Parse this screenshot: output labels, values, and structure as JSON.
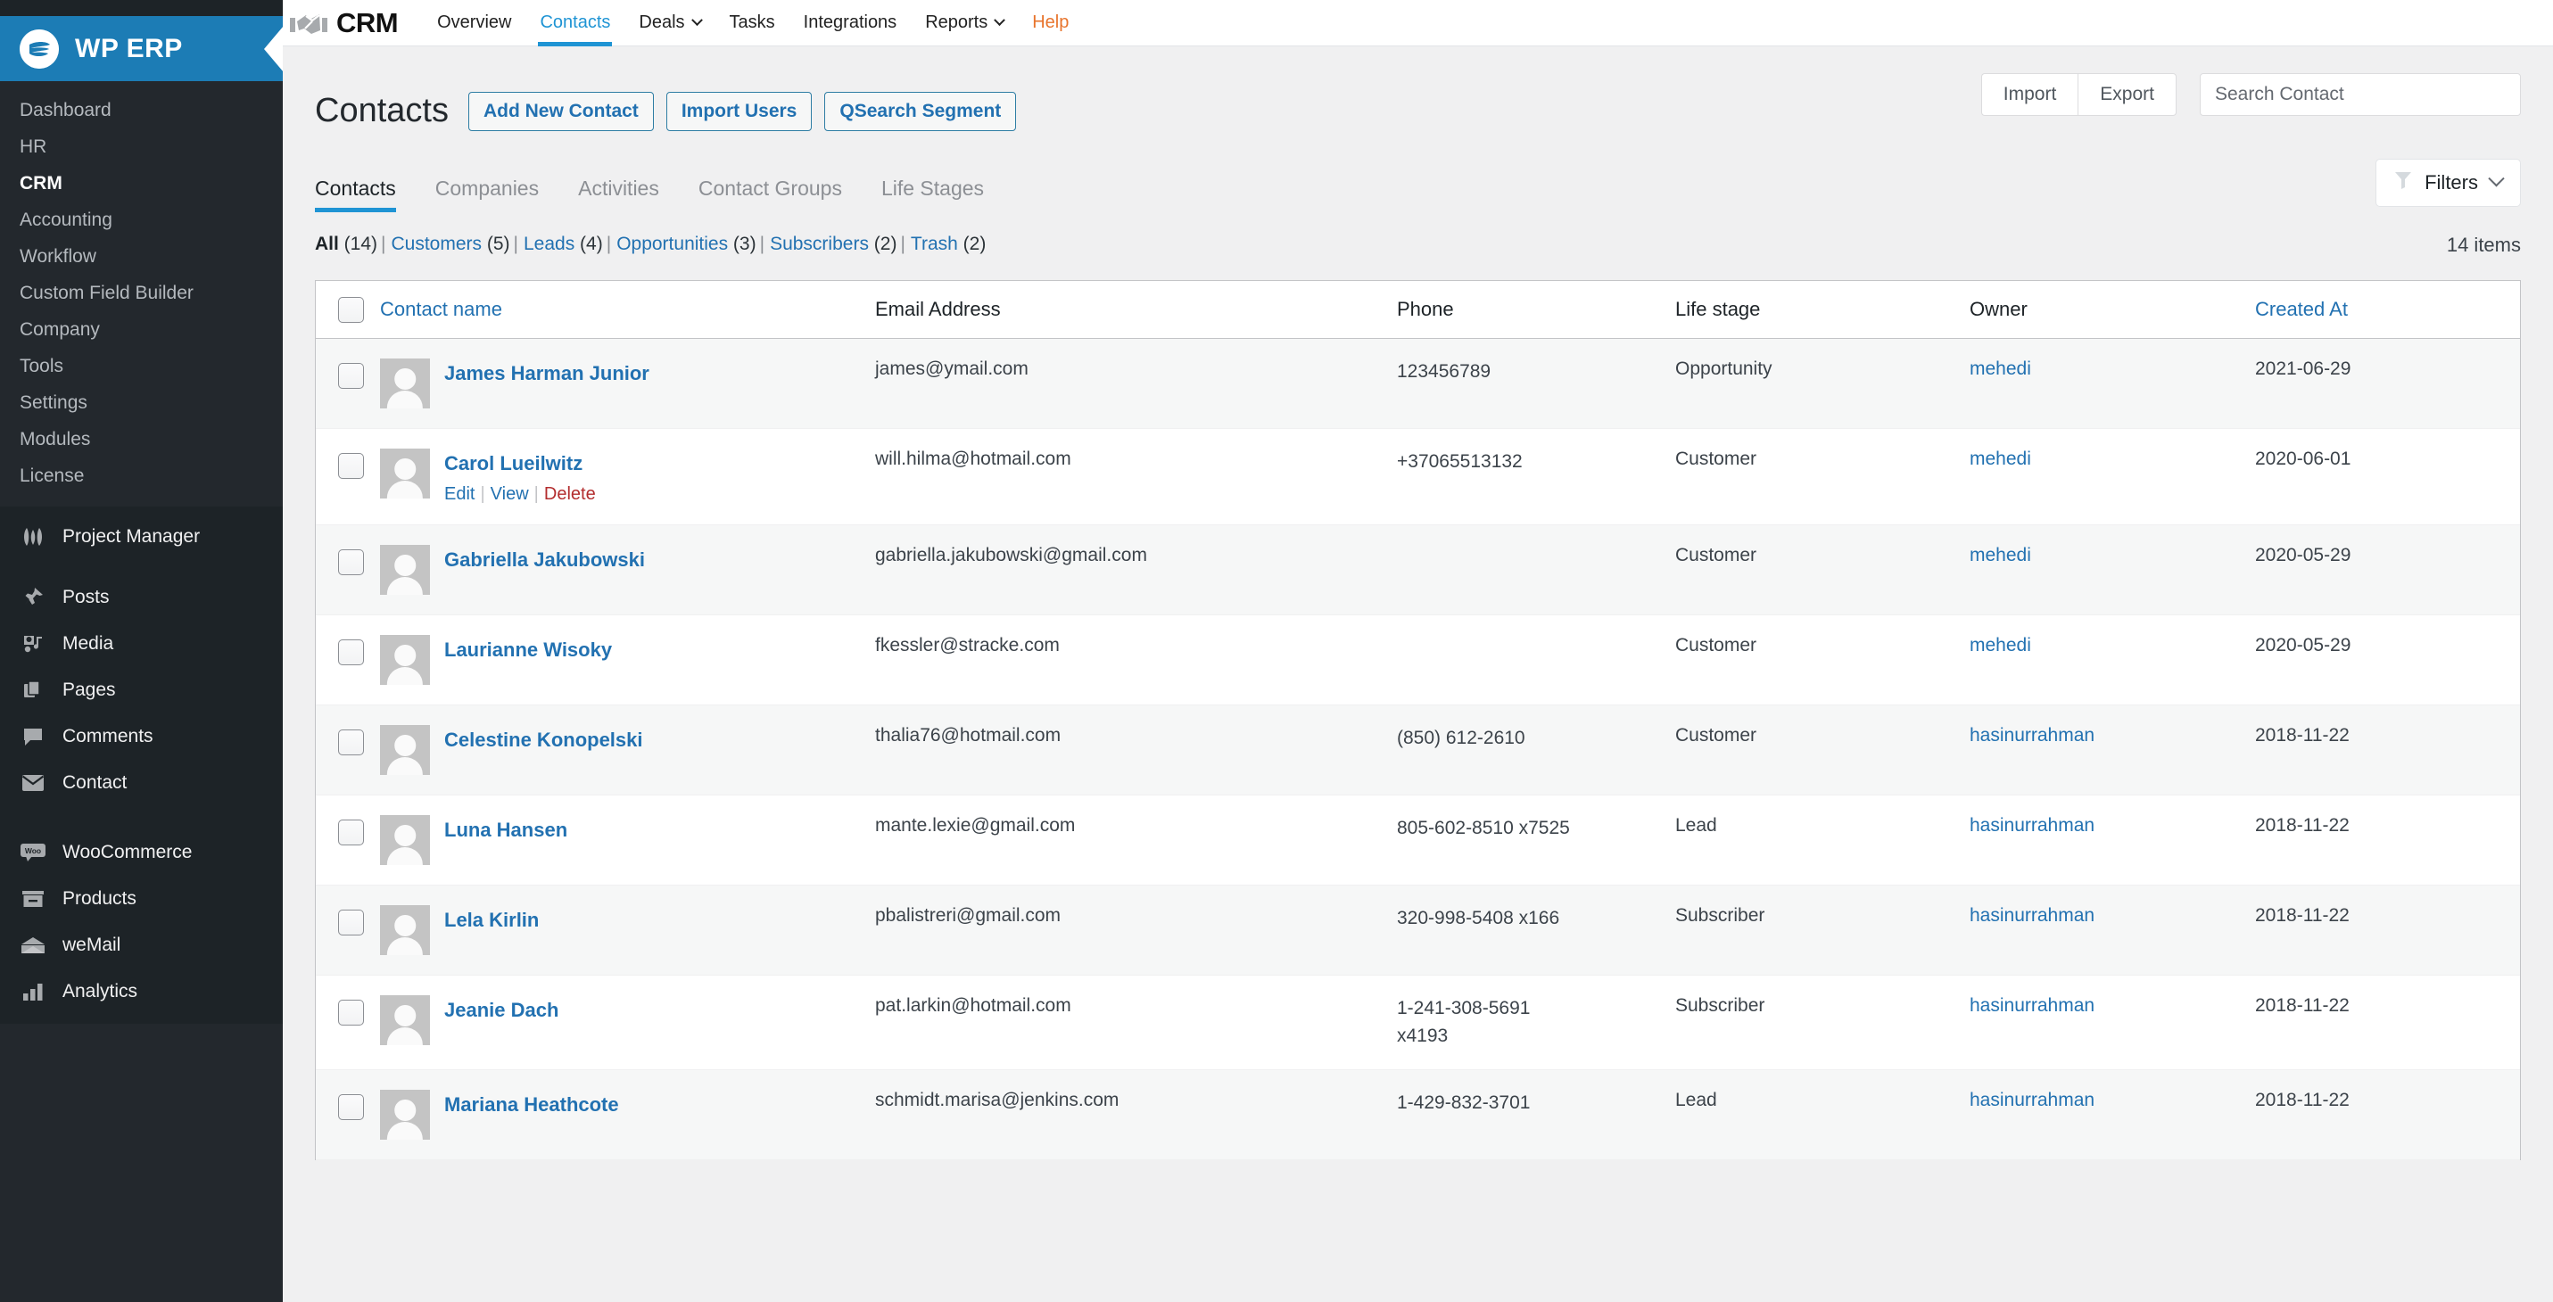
{
  "sidebar": {
    "brand": {
      "label": "WP ERP",
      "logo_icon": "wperp-logo-icon"
    },
    "erp_items": [
      {
        "label": "Dashboard",
        "active": false
      },
      {
        "label": "HR",
        "active": false
      },
      {
        "label": "CRM",
        "active": true
      },
      {
        "label": "Accounting",
        "active": false
      },
      {
        "label": "Workflow",
        "active": false
      },
      {
        "label": "Custom Field Builder",
        "active": false
      },
      {
        "label": "Company",
        "active": false
      },
      {
        "label": "Tools",
        "active": false
      },
      {
        "label": "Settings",
        "active": false
      },
      {
        "label": "Modules",
        "active": false
      },
      {
        "label": "License",
        "active": false
      }
    ],
    "wp_group_1": [
      {
        "label": "Project Manager",
        "icon": "project-manager-icon"
      }
    ],
    "wp_group_2": [
      {
        "label": "Posts",
        "icon": "pin-icon"
      },
      {
        "label": "Media",
        "icon": "media-icon"
      },
      {
        "label": "Pages",
        "icon": "pages-icon"
      },
      {
        "label": "Comments",
        "icon": "comment-bubble-icon"
      },
      {
        "label": "Contact",
        "icon": "envelope-icon"
      }
    ],
    "wp_group_3": [
      {
        "label": "WooCommerce",
        "icon": "woocommerce-icon"
      },
      {
        "label": "Products",
        "icon": "products-box-icon"
      },
      {
        "label": "weMail",
        "icon": "wemail-envelope-icon"
      },
      {
        "label": "Analytics",
        "icon": "analytics-bars-icon"
      }
    ]
  },
  "crmbar": {
    "icon": "handshake-icon",
    "title": "CRM",
    "nav": [
      {
        "label": "Overview",
        "state": "normal",
        "caret": false
      },
      {
        "label": "Contacts",
        "state": "selected",
        "caret": false
      },
      {
        "label": "Deals",
        "state": "normal",
        "caret": true
      },
      {
        "label": "Tasks",
        "state": "normal",
        "caret": false
      },
      {
        "label": "Integrations",
        "state": "normal",
        "caret": false
      },
      {
        "label": "Reports",
        "state": "normal",
        "caret": true
      },
      {
        "label": "Help",
        "state": "help",
        "caret": false
      }
    ]
  },
  "page": {
    "title": "Contacts",
    "buttons": [
      {
        "label": "Add New Contact",
        "icon": null
      },
      {
        "label": "Import Users",
        "icon": null
      },
      {
        "label": "Search Segment",
        "icon": "search-glyph"
      }
    ],
    "import_label": "Import",
    "export_label": "Export",
    "search_placeholder": "Search Contact",
    "filters_label": "Filters",
    "items_count": "14 items"
  },
  "subtabs": [
    {
      "label": "Contacts",
      "selected": true
    },
    {
      "label": "Companies",
      "selected": false
    },
    {
      "label": "Activities",
      "selected": false
    },
    {
      "label": "Contact Groups",
      "selected": false
    },
    {
      "label": "Life Stages",
      "selected": false
    }
  ],
  "status_links": [
    {
      "label": "All",
      "count": "(14)",
      "current": true
    },
    {
      "label": "Customers",
      "count": "(5)",
      "current": false
    },
    {
      "label": "Leads",
      "count": "(4)",
      "current": false
    },
    {
      "label": "Opportunities",
      "count": "(3)",
      "current": false
    },
    {
      "label": "Subscribers",
      "count": "(2)",
      "current": false
    },
    {
      "label": "Trash",
      "count": "(2)",
      "current": false
    }
  ],
  "table": {
    "columns": [
      {
        "label": "Contact name",
        "link": true
      },
      {
        "label": "Email Address",
        "link": false
      },
      {
        "label": "Phone",
        "link": false
      },
      {
        "label": "Life stage",
        "link": false
      },
      {
        "label": "Owner",
        "link": false
      },
      {
        "label": "Created At",
        "link": true
      }
    ],
    "row_actions": {
      "edit": "Edit",
      "view": "View",
      "delete": "Delete"
    },
    "rows": [
      {
        "name": "James Harman Junior",
        "email": "james@ymail.com",
        "phone": "123456789",
        "phone2": "",
        "life_stage": "Opportunity",
        "owner": "mehedi",
        "created_at": "2021-06-29",
        "show_actions": false
      },
      {
        "name": "Carol Lueilwitz",
        "email": "will.hilma@hotmail.com",
        "phone": "+37065513132",
        "phone2": "",
        "life_stage": "Customer",
        "owner": "mehedi",
        "created_at": "2020-06-01",
        "show_actions": true
      },
      {
        "name": "Gabriella Jakubowski",
        "email": "gabriella.jakubowski@gmail.com",
        "phone": "",
        "phone2": "",
        "life_stage": "Customer",
        "owner": "mehedi",
        "created_at": "2020-05-29",
        "show_actions": false
      },
      {
        "name": "Laurianne Wisoky",
        "email": "fkessler@stracke.com",
        "phone": "",
        "phone2": "",
        "life_stage": "Customer",
        "owner": "mehedi",
        "created_at": "2020-05-29",
        "show_actions": false
      },
      {
        "name": "Celestine Konopelski",
        "email": "thalia76@hotmail.com",
        "phone": "(850) 612-2610",
        "phone2": "",
        "life_stage": "Customer",
        "owner": "hasinurrahman",
        "created_at": "2018-11-22",
        "show_actions": false
      },
      {
        "name": "Luna Hansen",
        "email": "mante.lexie@gmail.com",
        "phone": "805-602-8510 x7525",
        "phone2": "",
        "life_stage": "Lead",
        "owner": "hasinurrahman",
        "created_at": "2018-11-22",
        "show_actions": false
      },
      {
        "name": "Lela Kirlin",
        "email": "pbalistreri@gmail.com",
        "phone": "320-998-5408 x166",
        "phone2": "",
        "life_stage": "Subscriber",
        "owner": "hasinurrahman",
        "created_at": "2018-11-22",
        "show_actions": false
      },
      {
        "name": "Jeanie Dach",
        "email": "pat.larkin@hotmail.com",
        "phone": "1-241-308-5691",
        "phone2": "x4193",
        "life_stage": "Subscriber",
        "owner": "hasinurrahman",
        "created_at": "2018-11-22",
        "show_actions": false
      },
      {
        "name": "Mariana Heathcote",
        "email": "schmidt.marisa@jenkins.com",
        "phone": "1-429-832-3701",
        "phone2": "",
        "life_stage": "Lead",
        "owner": "hasinurrahman",
        "created_at": "2018-11-22",
        "show_actions": false
      }
    ]
  },
  "colors": {
    "brand_blue": "#1c7cb5",
    "link_blue": "#2271b1",
    "accent_blue": "#1f94d4",
    "help_orange": "#e8742c",
    "delete_red": "#b32d2e",
    "sidebar_dark": "#23282d",
    "sidebar_darker": "#1d2327"
  }
}
